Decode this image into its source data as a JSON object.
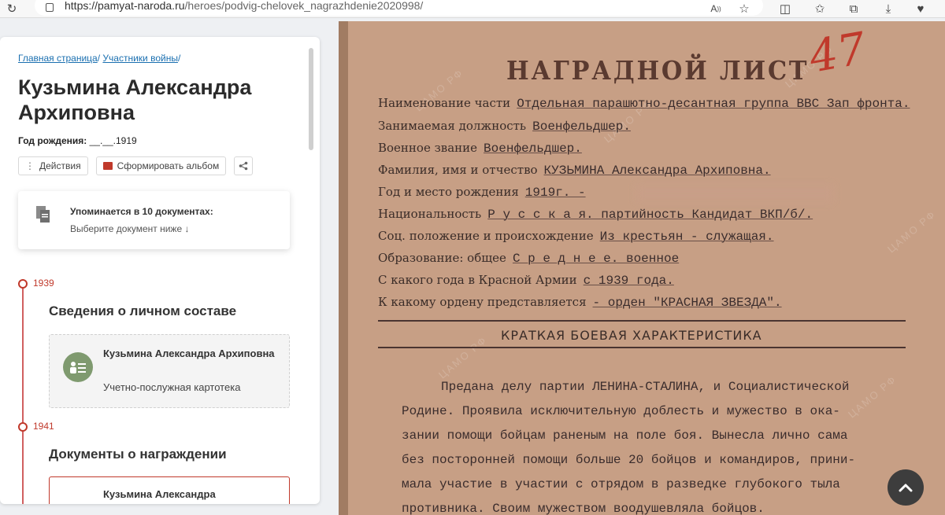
{
  "browser": {
    "url_host": "https://pamyat-naroda.ru",
    "url_path": "/heroes/podvig-chelovek_nagrazhdenie2020998/"
  },
  "breadcrumb": {
    "home": "Главная страница",
    "sep1": "/",
    "participants": "Участники войны",
    "sep2": "/"
  },
  "person": {
    "name": "Кузьмина Александра Архиповна",
    "birth_label": "Год рождения:",
    "birth_value": "__.__.1919"
  },
  "actions": {
    "actions_label": "Действия",
    "album_label": "Сформировать альбом"
  },
  "documents_card": {
    "title": "Упоминается в 10 документах:",
    "subtitle": "Выберите документ ниже ↓"
  },
  "timeline": [
    {
      "year": "1939",
      "section": "Сведения о личном составе",
      "record_name": "Кузьмина Александра Архиповна",
      "record_type": "Учетно-послужная картотека"
    },
    {
      "year": "1941",
      "section": "Документы о награждении",
      "record_name": "Кузьмина Александра"
    }
  ],
  "document": {
    "title": "НАГРАДНОЙ ЛИСТ",
    "number": "47",
    "fields": [
      {
        "label": "Наименование части",
        "value": "Отдельная парашютно-десантная группа ВВС Зап фронта."
      },
      {
        "label": "Занимаемая должность",
        "value": "Военфельдшер."
      },
      {
        "label": "Военное звание",
        "value": "Военфельдшер."
      },
      {
        "label": "Фамилия, имя и отчество",
        "value": "КУЗЬМИНА Александра Архиповна."
      },
      {
        "label": "Год и место рождения",
        "value": "1919г. -"
      },
      {
        "label": "Национальность",
        "value": "Р у с с к а я.   партийность Кандидат ВКП/б/."
      },
      {
        "label": "Соц. положение и происхождение",
        "value": "Из крестьян - служащая."
      },
      {
        "label": "Образование: общее",
        "value": "С р е д н е е.   военное"
      },
      {
        "label": "С какого года в Красной Армии",
        "value": "с 1939 года."
      },
      {
        "label": "К какому ордену представляется",
        "value": "- орден \"КРАСНАЯ ЗВЕЗДА\"."
      }
    ],
    "characteristic_title": "КРАТКАЯ БОЕВАЯ ХАРАКТЕРИСТИКА",
    "body": [
      "Предана делу партии ЛЕНИНА-СТАЛИНА, и Социалистической",
      "Родине. Проявила исключительную доблесть и мужество в ока-",
      "зании помощи бойцам раненым на поле боя. Вынесла лично сама",
      "без посторонней помощи больше 20 бойцов и командиров, прини-",
      "мала участие в участии с отрядом в разведке глубокого тыла",
      "противника. Своим мужеством воодушевляла бойцов."
    ],
    "watermark": "ЦАМО РФ"
  },
  "colors": {
    "accent": "#c0392b",
    "link": "#1a6fb0",
    "paper": "#c79f85"
  }
}
